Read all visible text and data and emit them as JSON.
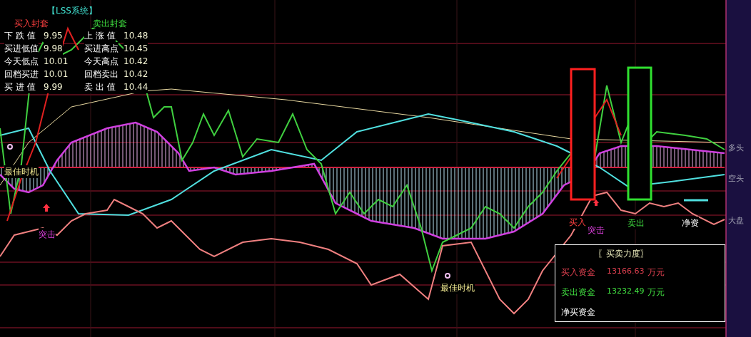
{
  "title": "【LSS系统】",
  "envelopes": [
    {
      "heading": "买入封套",
      "kind": "buy",
      "rows": [
        {
          "label": "下 跌 值",
          "value": "9.95"
        },
        {
          "label": "买进低值",
          "value": "9.98"
        },
        {
          "label": "今天低点",
          "value": "10.01"
        },
        {
          "label": "回档买进",
          "value": "10.01"
        },
        {
          "label": "买 进 值",
          "value": "9.99"
        }
      ]
    },
    {
      "heading": "卖出封套",
      "kind": "sell",
      "rows": [
        {
          "label": "上 涨 值",
          "value": "10.48"
        },
        {
          "label": "买进高点",
          "value": "10.45"
        },
        {
          "label": "今天高点",
          "value": "10.42"
        },
        {
          "label": "回档卖出",
          "value": "10.42"
        },
        {
          "label": "卖 出 值",
          "value": "10.44"
        }
      ]
    }
  ],
  "chart_labels": [
    {
      "text": "最佳时机",
      "kind": "timing"
    },
    {
      "text": "突击",
      "kind": "attack"
    },
    {
      "text": "最佳时机",
      "kind": "timing"
    },
    {
      "text": "买入",
      "kind": "buy"
    },
    {
      "text": "突击",
      "kind": "attack"
    },
    {
      "text": "卖出",
      "kind": "sell"
    },
    {
      "text": "净资",
      "kind": "net"
    }
  ],
  "axis_labels": [
    "多头",
    "空头",
    "大盘"
  ],
  "strength_panel": {
    "title": "〖买卖力度〗",
    "rows": [
      {
        "label": "买入资金",
        "value": "13166.63",
        "unit": "万元",
        "kind": "buy"
      },
      {
        "label": "卖出资金",
        "value": "13232.49",
        "unit": "万元",
        "kind": "sell"
      },
      {
        "label": "净买资金",
        "kind": "net"
      }
    ]
  }
}
